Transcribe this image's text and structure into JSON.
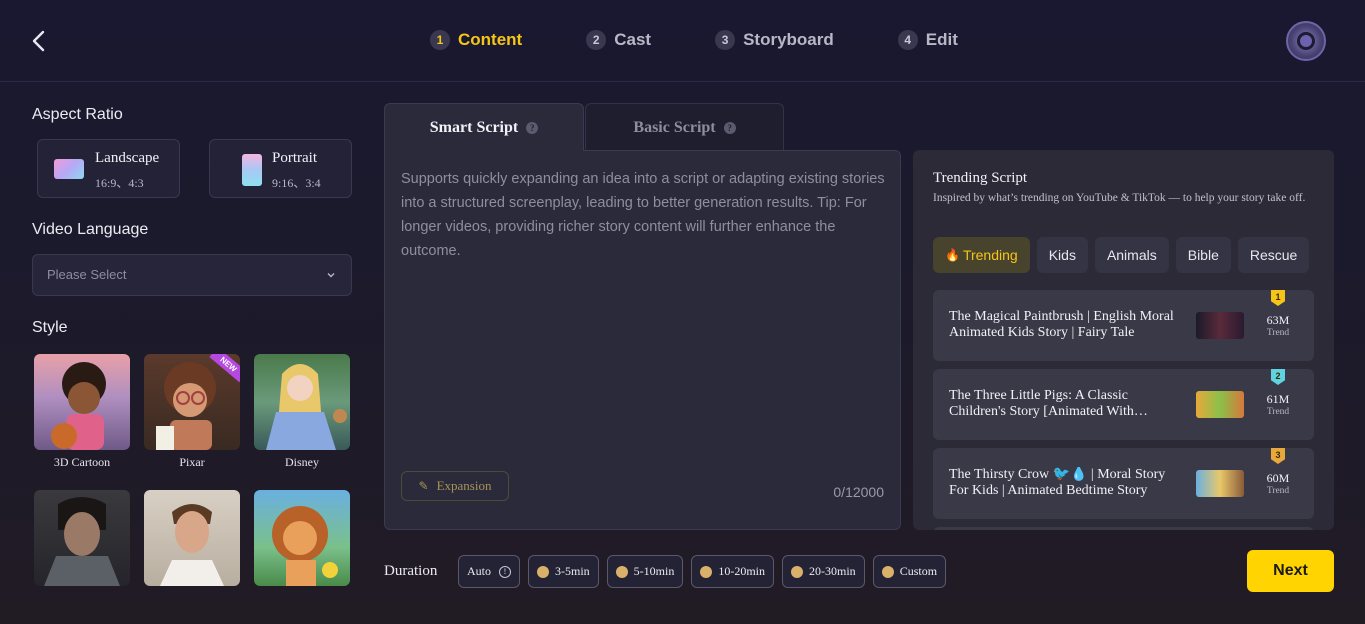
{
  "steps": [
    {
      "num": "1",
      "label": "Content"
    },
    {
      "num": "2",
      "label": "Cast"
    },
    {
      "num": "3",
      "label": "Storyboard"
    },
    {
      "num": "4",
      "label": "Edit"
    }
  ],
  "aspect": {
    "title": "Aspect Ratio",
    "landscape": {
      "label": "Landscape",
      "ratios": "16:9、4:3"
    },
    "portrait": {
      "label": "Portrait",
      "ratios": "9:16、3:4"
    }
  },
  "language": {
    "title": "Video Language",
    "placeholder": "Please Select"
  },
  "style": {
    "title": "Style",
    "items": [
      {
        "label": "3D Cartoon"
      },
      {
        "label": "Pixar",
        "badge": "NEW"
      },
      {
        "label": "Disney"
      },
      {
        "label": ""
      },
      {
        "label": ""
      },
      {
        "label": ""
      }
    ]
  },
  "script": {
    "tabs": [
      {
        "label": "Smart Script"
      },
      {
        "label": "Basic Script"
      }
    ],
    "placeholder": "Supports quickly expanding an idea into a script or adapting existing stories into a structured screenplay, leading to better generation results. Tip: For longer videos, providing richer story content will further enhance the outcome.",
    "expansion_label": "Expansion",
    "counter": "0/12000"
  },
  "trending": {
    "title": "Trending Script",
    "subtitle": "Inspired by what’s trending on YouTube & TikTok — to help your story take off.",
    "chips": [
      "Trending",
      "Kids",
      "Animals",
      "Bible",
      "Rescue"
    ],
    "items": [
      {
        "rank": "1",
        "title": "The Magical Paintbrush | English Moral Animated Kids Story | Fairy Tale",
        "value": "63M",
        "label": "Trend",
        "rank_color": "#f5c518"
      },
      {
        "rank": "2",
        "title": "The Three Little Pigs: A Classic Children's Story [Animated With…",
        "value": "61M",
        "label": "Trend",
        "rank_color": "#5fd4e0"
      },
      {
        "rank": "3",
        "title": "The Thirsty Crow 🐦💧 | Moral Story For Kids | Animated Bedtime Story",
        "value": "60M",
        "label": "Trend",
        "rank_color": "#e9a93a"
      }
    ]
  },
  "duration": {
    "label": "Duration",
    "options": [
      "Auto",
      "3-5min",
      "5-10min",
      "10-20min",
      "20-30min",
      "Custom"
    ]
  },
  "next_label": "Next"
}
